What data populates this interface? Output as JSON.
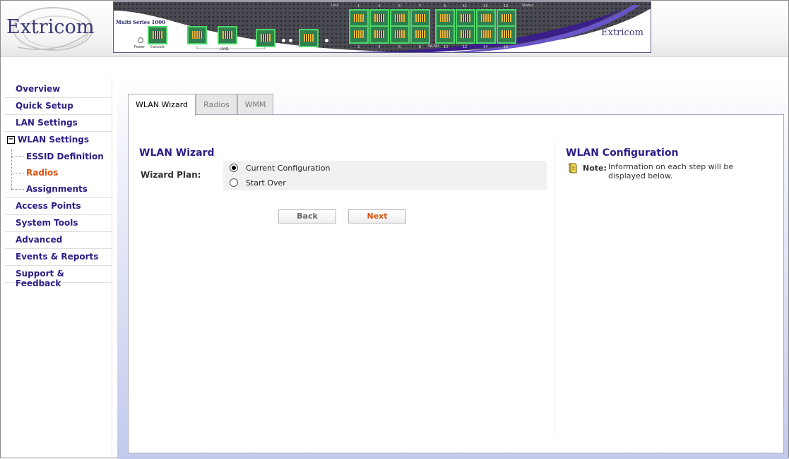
{
  "header": {
    "logo": "Extricom",
    "device": {
      "model": "Multi Series 1000",
      "brand": "Extricom",
      "labels": {
        "power": "Power",
        "console": "Console",
        "lan1": "LAN1",
        "link": "Link",
        "status": "Status",
        "wlan": "WLAN",
        "port_top": [
          "1",
          "3",
          "5",
          "7",
          "9",
          "11",
          "13",
          "15"
        ],
        "port_bottom": [
          "2",
          "4",
          "6",
          "8",
          "10",
          "12",
          "14",
          "16"
        ]
      }
    }
  },
  "sidebar": {
    "items": [
      {
        "label": "Overview"
      },
      {
        "label": "Quick Setup"
      },
      {
        "label": "LAN Settings"
      },
      {
        "label": "WLAN Settings",
        "expanded": true,
        "toggle": "−"
      },
      {
        "label": "ESSID Definition"
      },
      {
        "label": "Radios",
        "active": true
      },
      {
        "label": "Assignments"
      },
      {
        "label": "Access Points"
      },
      {
        "label": "System Tools"
      },
      {
        "label": "Advanced"
      },
      {
        "label": "Events & Reports"
      },
      {
        "label": "Support & Feedback"
      }
    ]
  },
  "tabs": [
    {
      "label": "WLAN Wizard",
      "active": true
    },
    {
      "label": "Radios"
    },
    {
      "label": "WMM"
    }
  ],
  "wizard": {
    "title": "WLAN Wizard",
    "plan_label": "Wizard Plan:",
    "options": [
      {
        "label": "Current Configuration",
        "selected": true
      },
      {
        "label": "Start Over",
        "selected": false
      }
    ],
    "back_label": "Back",
    "next_label": "Next"
  },
  "config": {
    "title": "WLAN Configuration",
    "note_label": "Note:",
    "note_text": "Information on each step will be displayed below.",
    "note_icon": "note-book-icon"
  },
  "colors": {
    "nav_text": "#2a1f86",
    "active": "#d9540f",
    "port_green": "#4fd66a",
    "device_purple": "#3a1f8a"
  }
}
